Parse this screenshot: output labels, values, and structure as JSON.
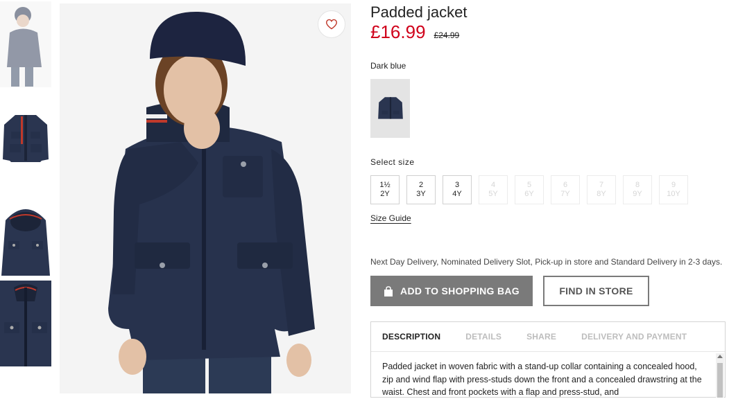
{
  "product": {
    "title": "Padded jacket",
    "price_now": "£16.99",
    "price_old": "£24.99",
    "color_name": "Dark blue"
  },
  "size": {
    "label": "Select size",
    "options": [
      {
        "top": "1½",
        "bottom": "2Y",
        "available": true
      },
      {
        "top": "2",
        "bottom": "3Y",
        "available": true
      },
      {
        "top": "3",
        "bottom": "4Y",
        "available": true
      },
      {
        "top": "4",
        "bottom": "5Y",
        "available": false
      },
      {
        "top": "5",
        "bottom": "6Y",
        "available": false
      },
      {
        "top": "6",
        "bottom": "7Y",
        "available": false
      },
      {
        "top": "7",
        "bottom": "8Y",
        "available": false
      },
      {
        "top": "8",
        "bottom": "9Y",
        "available": false
      },
      {
        "top": "9",
        "bottom": "10Y",
        "available": false
      }
    ],
    "guide_label": "Size Guide"
  },
  "delivery_text": "Next Day Delivery, Nominated Delivery Slot, Pick-up in store and Standard Delivery in 2-3 days.",
  "buttons": {
    "add_to_bag": "ADD TO SHOPPING BAG",
    "find_in_store": "FIND IN STORE"
  },
  "tabs": [
    {
      "label": "DESCRIPTION",
      "active": true
    },
    {
      "label": "DETAILS",
      "active": false
    },
    {
      "label": "SHARE",
      "active": false
    },
    {
      "label": "DELIVERY AND PAYMENT",
      "active": false
    }
  ],
  "description": "Padded jacket in woven fabric with a stand-up collar containing a concealed hood, zip and wind flap with press-studs down the front and a concealed drawstring at the waist. Chest and front pockets with a flap and press-stud, and",
  "icons": {
    "favorite": "heart-icon",
    "bag": "shopping-bag-icon"
  },
  "colors": {
    "price_sale": "#d0021b",
    "button_grey": "#7a7a7a",
    "jacket_navy": "#2a3550"
  }
}
